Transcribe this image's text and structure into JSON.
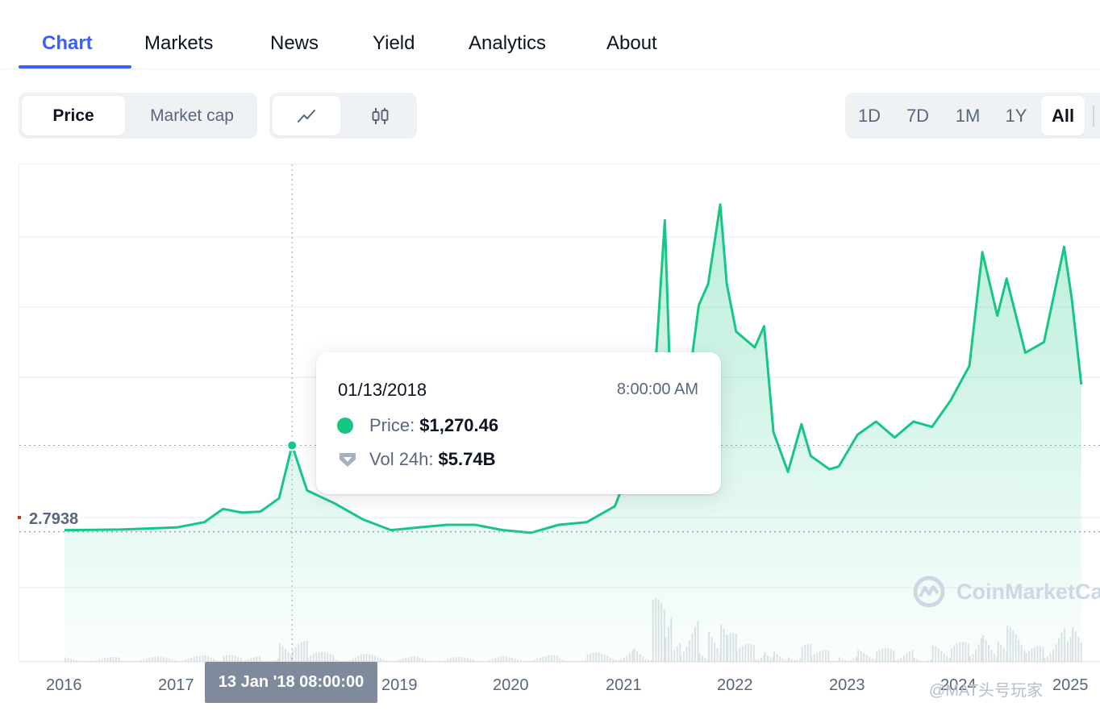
{
  "tabs": [
    {
      "label": "Chart",
      "active": true
    },
    {
      "label": "Markets"
    },
    {
      "label": "News"
    },
    {
      "label": "Yield"
    },
    {
      "label": "Analytics"
    },
    {
      "label": "About"
    }
  ],
  "toggles": {
    "metric": [
      {
        "label": "Price",
        "active": true
      },
      {
        "label": "Market cap"
      }
    ],
    "chart_type_icons": [
      "line-chart-icon",
      "candlestick-icon"
    ],
    "ranges": [
      {
        "label": "1D"
      },
      {
        "label": "7D"
      },
      {
        "label": "1M"
      },
      {
        "label": "1Y"
      },
      {
        "label": "All",
        "active": true
      }
    ]
  },
  "chart": {
    "reference_value": "2.7938",
    "hover_date_label": "13 Jan '18 08:00:00",
    "watermark": "CoinMarketCap",
    "corner_mark": "@MAT头号玩家",
    "colors": {
      "line": "#16c784",
      "volume": "#dfe3e8",
      "grid": "#eff2f5",
      "reference": "#9aa3b2"
    }
  },
  "chart_data": {
    "type": "line",
    "x_ticks": [
      "2016",
      "2017",
      "2018",
      "2019",
      "2020",
      "2021",
      "2022",
      "2023",
      "2024",
      "2025"
    ],
    "series": [
      {
        "x": [
          "2016-01",
          "2016-07",
          "2017-01",
          "2017-04",
          "2017-06",
          "2017-08",
          "2017-10",
          "2017-12",
          "2018-01-13",
          "2018-03",
          "2018-06",
          "2018-09",
          "2018-12",
          "2019-03",
          "2019-06",
          "2019-09",
          "2019-12",
          "2020-03",
          "2020-06",
          "2020-09",
          "2020-12",
          "2021-02",
          "2021-04",
          "2021-05-12",
          "2021-06",
          "2021-07",
          "2021-09",
          "2021-10",
          "2021-11-10",
          "2021-12",
          "2022-01",
          "2022-03",
          "2022-04",
          "2022-05",
          "2022-06-18",
          "2022-08",
          "2022-09",
          "2022-11",
          "2022-12",
          "2023-02",
          "2023-04",
          "2023-06",
          "2023-08",
          "2023-10",
          "2023-12",
          "2024-02",
          "2024-03-13",
          "2024-05",
          "2024-06",
          "2024-08",
          "2024-10",
          "2024-12-06",
          "2025-01",
          "2025-02"
        ],
        "y": [
          0.95,
          0.96,
          1.0,
          1.1,
          1.35,
          1.28,
          1.3,
          1.55,
          2.55,
          1.7,
          1.45,
          1.15,
          0.95,
          1.0,
          1.05,
          1.05,
          0.95,
          0.9,
          1.05,
          1.1,
          1.4,
          2.3,
          3.1,
          6.8,
          3.4,
          2.5,
          5.2,
          5.6,
          7.1,
          5.6,
          4.7,
          4.4,
          4.8,
          2.8,
          2.05,
          2.95,
          2.35,
          2.1,
          2.15,
          2.75,
          3.0,
          2.7,
          3.0,
          2.9,
          3.4,
          4.05,
          6.2,
          5.0,
          5.7,
          4.3,
          4.5,
          6.3,
          5.3,
          3.7
        ]
      }
    ],
    "tooltip": {
      "date": "01/13/2018",
      "time": "8:00:00 AM",
      "price_label": "Price:",
      "price_value": "$1,270.46",
      "volume_label": "Vol 24h:",
      "volume_value": "$5.74B"
    }
  }
}
